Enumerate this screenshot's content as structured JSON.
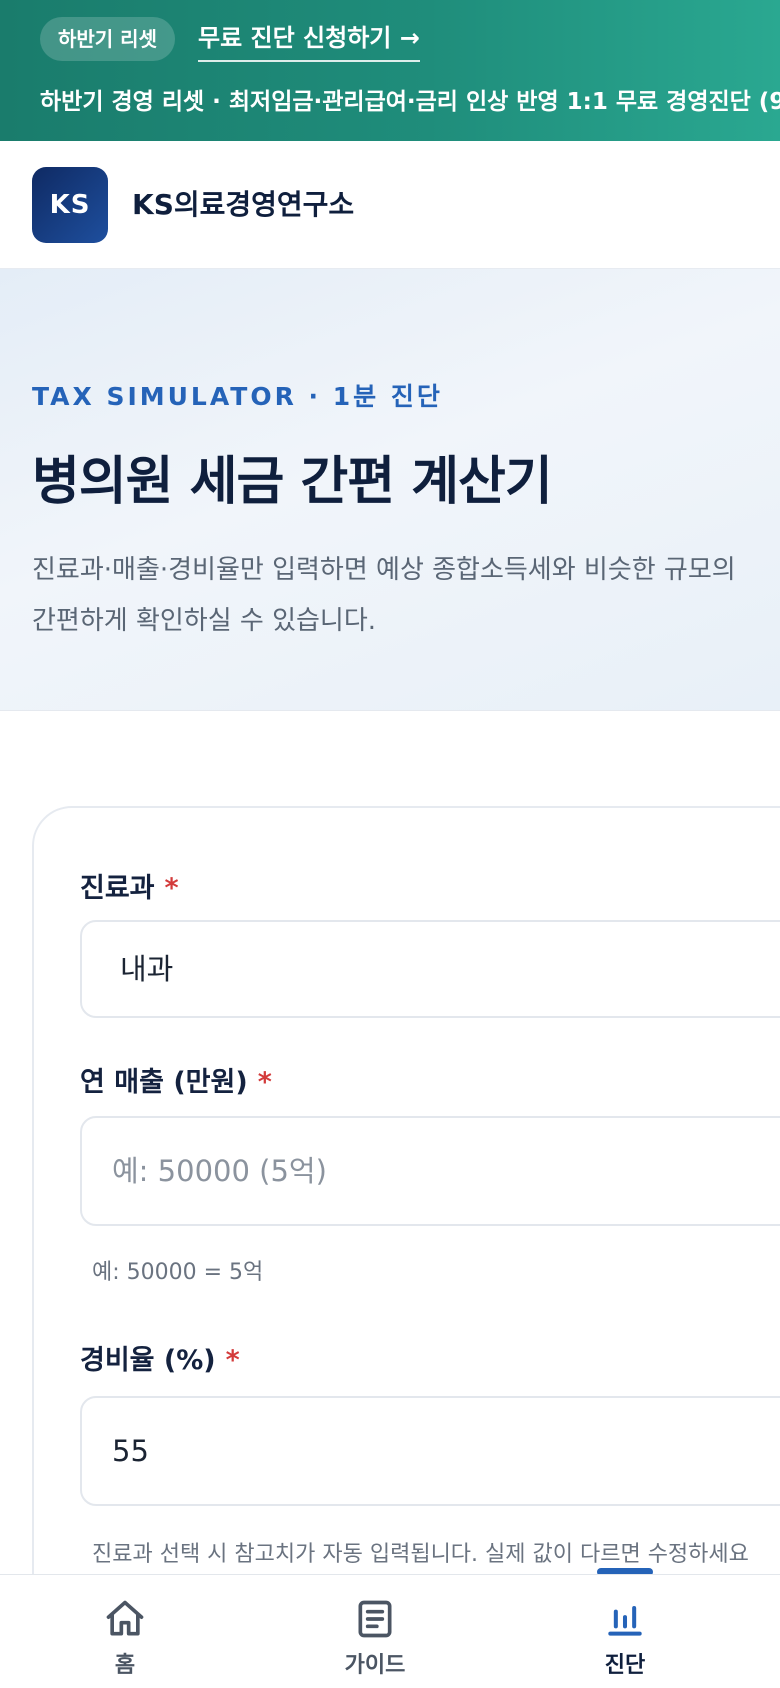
{
  "promo": {
    "chip": "하반기 리셋",
    "link": "무료 진단 신청하기 →",
    "marquee": "하반기 경영 리셋 · 최저임금·관리급여·금리 인상 반영 1:1 무료 경영진단 (9/"
  },
  "header": {
    "logo": "KS",
    "brand": "KS의료경영연구소"
  },
  "hero": {
    "eyebrow": "TAX SIMULATOR · 1분 진단",
    "title": "병의원 세금 간편 계산기",
    "desc_line1": "진료과·매출·경비율만 입력하면 예상 종합소득세와 비슷한 규모의",
    "desc_line2": "간편하게 확인하실 수 있습니다."
  },
  "form": {
    "department": {
      "label": "진료과",
      "required": "*",
      "value": "내과"
    },
    "revenue": {
      "label": "연 매출 (만원)",
      "required": "*",
      "placeholder": "예: 50000 (5억)",
      "hint": "예: 50000 = 5억"
    },
    "expense": {
      "label": "경비율 (%)",
      "required": "*",
      "value": "55",
      "hint": "진료과 선택 시 참고치가 자동 입력됩니다. 실제 값이 다르면 수정하세요"
    }
  },
  "nav": {
    "items": [
      {
        "label": "홈",
        "icon": "home-icon"
      },
      {
        "label": "가이드",
        "icon": "document-icon"
      },
      {
        "label": "진단",
        "icon": "bar-chart-icon"
      }
    ],
    "active": "진단",
    "accent": "#2563b8"
  }
}
